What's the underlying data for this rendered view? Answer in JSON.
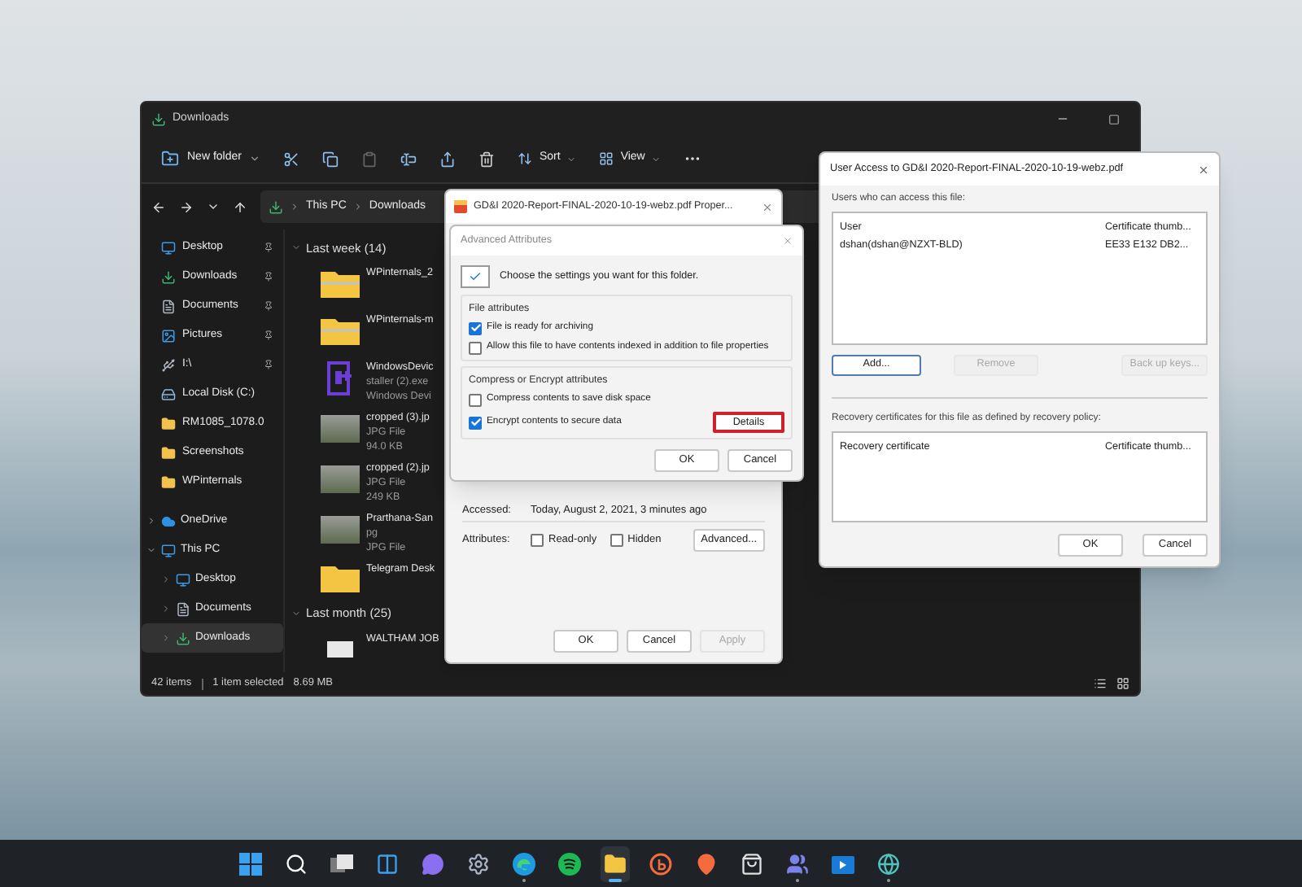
{
  "explorer": {
    "title": "Downloads",
    "toolbar": {
      "new_folder": "New folder",
      "sort": "Sort",
      "view": "View"
    },
    "address": [
      "This PC",
      "Downloads"
    ],
    "sidebar": {
      "quick_access": [
        {
          "label": "Desktop",
          "kind": "desktop",
          "pinned": true
        },
        {
          "label": "Downloads",
          "kind": "downloads",
          "pinned": true
        },
        {
          "label": "Documents",
          "kind": "documents",
          "pinned": true
        },
        {
          "label": "Pictures",
          "kind": "pictures",
          "pinned": true
        },
        {
          "label": "I:\\",
          "kind": "drive",
          "pinned": true
        },
        {
          "label": "Local Disk (C:)",
          "kind": "disk",
          "pinned": false
        },
        {
          "label": "RM1085_1078.0",
          "kind": "folder",
          "pinned": false
        },
        {
          "label": "Screenshots",
          "kind": "folder",
          "pinned": false
        },
        {
          "label": "WPinternals",
          "kind": "folder",
          "pinned": false
        }
      ],
      "tree": [
        {
          "label": "OneDrive",
          "kind": "cloud",
          "expanded": false,
          "selected": false
        },
        {
          "label": "This PC",
          "kind": "pc",
          "expanded": true,
          "selected": false,
          "children": [
            {
              "label": "Desktop",
              "kind": "desktop",
              "expanded": false,
              "selected": false
            },
            {
              "label": "Documents",
              "kind": "documents",
              "expanded": false,
              "selected": false
            },
            {
              "label": "Downloads",
              "kind": "downloads",
              "expanded": false,
              "selected": true
            }
          ]
        }
      ]
    },
    "groups": [
      {
        "label": "Last week (14)",
        "expanded": true,
        "files": [
          {
            "kind": "zip",
            "lines": [
              "WPinternals_2"
            ]
          },
          {
            "kind": "zip",
            "lines": [
              "WPinternals-m"
            ]
          },
          {
            "kind": "app",
            "lines": [
              "WindowsDevic",
              "staller (2).exe",
              "Windows Devi"
            ]
          },
          {
            "kind": "photo",
            "lines": [
              "cropped (3).jp",
              "JPG File",
              "94.0 KB"
            ]
          },
          {
            "kind": "photo",
            "lines": [
              "cropped (2).jp",
              "JPG File",
              "249 KB"
            ]
          },
          {
            "kind": "photo",
            "lines": [
              "Prarthana-San",
              "pg",
              "JPG File"
            ]
          },
          {
            "kind": "folder",
            "lines": [
              "Telegram Desk"
            ]
          }
        ]
      },
      {
        "label": "Last month (25)",
        "expanded": true,
        "files": [
          {
            "kind": "document",
            "lines": [
              "WALTHAM JOB"
            ]
          }
        ]
      }
    ],
    "status_bar": [
      "42 items",
      "1 item selected",
      "8.69 MB"
    ]
  },
  "properties_dialog": {
    "title": "GD&I 2020-Report-FINAL-2020-10-19-webz.pdf Proper...",
    "accessed_label": "Accessed:",
    "accessed_value": "Today, August 2, 2021, 3 minutes ago",
    "attributes_label": "Attributes:",
    "attributes": [
      {
        "label": "Read-only",
        "checked": false
      },
      {
        "label": "Hidden",
        "checked": false
      }
    ],
    "advanced_button": "Advanced...",
    "buttons": [
      {
        "label": "OK",
        "disabled": false
      },
      {
        "label": "Cancel",
        "disabled": false
      },
      {
        "label": "Apply",
        "disabled": true
      }
    ]
  },
  "advanced_dialog": {
    "title": "Advanced Attributes",
    "intro": "Choose the settings you want for this folder.",
    "groups": [
      {
        "title": "File attributes",
        "options": [
          {
            "label": "File is ready for archiving",
            "checked": true
          },
          {
            "label": "Allow this file to have contents indexed in addition to file properties",
            "checked": false
          }
        ]
      },
      {
        "title": "Compress or Encrypt attributes",
        "options": [
          {
            "label": "Compress contents to save disk space",
            "checked": false
          },
          {
            "label": "Encrypt contents to secure data",
            "checked": true
          }
        ]
      }
    ],
    "details_button": {
      "label": "Details",
      "highlighted": true
    },
    "buttons": [
      {
        "label": "OK",
        "disabled": false
      },
      {
        "label": "Cancel",
        "disabled": false
      }
    ]
  },
  "user_access_dialog": {
    "title": "User Access to GD&I 2020-Report-FINAL-2020-10-19-webz.pdf",
    "users_label": "Users who can access this file:",
    "users_columns": [
      "User",
      "Certificate thumb..."
    ],
    "users_rows": [
      [
        "dshan(dshan@NZXT-BLD)",
        "EE33 E132 DB2..."
      ]
    ],
    "actions": [
      {
        "label": "Add...",
        "disabled": false
      },
      {
        "label": "Remove",
        "disabled": true
      },
      {
        "label": "Back up keys...",
        "disabled": true
      }
    ],
    "recovery_label": "Recovery certificates for this file as defined by recovery policy:",
    "recovery_columns": [
      "Recovery certificate",
      "Certificate thumb..."
    ],
    "buttons": [
      {
        "label": "OK",
        "disabled": false
      },
      {
        "label": "Cancel",
        "disabled": false
      }
    ]
  },
  "taskbar": [
    {
      "kind": "start",
      "selected": false,
      "running": false
    },
    {
      "kind": "search",
      "selected": false,
      "running": false
    },
    {
      "kind": "taskview",
      "selected": false,
      "running": false
    },
    {
      "kind": "widgets",
      "selected": false,
      "running": false
    },
    {
      "kind": "chat",
      "selected": false,
      "running": false
    },
    {
      "kind": "settings",
      "selected": false,
      "running": false
    },
    {
      "kind": "browser",
      "selected": false,
      "running": true
    },
    {
      "kind": "music",
      "selected": false,
      "running": false
    },
    {
      "kind": "explorer",
      "selected": true,
      "running": true
    },
    {
      "kind": "bcircle",
      "selected": false,
      "running": false
    },
    {
      "kind": "pin",
      "selected": false,
      "running": false
    },
    {
      "kind": "store",
      "selected": false,
      "running": false
    },
    {
      "kind": "teams",
      "selected": false,
      "running": true
    },
    {
      "kind": "video",
      "selected": false,
      "running": false
    },
    {
      "kind": "globe",
      "selected": false,
      "running": true
    }
  ]
}
